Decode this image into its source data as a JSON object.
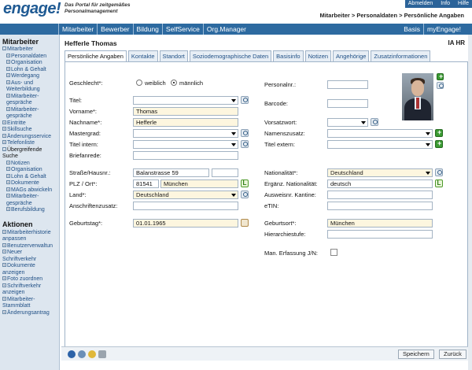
{
  "app": {
    "logo": "engage!",
    "tagline": "Das Portal für zeitgemäßes Personalmanagement",
    "top_links": [
      "Abmelden",
      "Info",
      "Hilfe"
    ],
    "breadcrumb": "Mitarbeiter > Personaldaten > Persönliche Angaben"
  },
  "nav": {
    "left": [
      "Mitarbeiter",
      "Bewerber",
      "Bildung",
      "SelfService",
      "Org.Manager"
    ],
    "right": [
      "Basis",
      "myEngage!"
    ]
  },
  "sidebar": {
    "section1": "Mitarbeiter",
    "items": [
      {
        "label": "Mitarbeiter",
        "level": 1,
        "sym": "-"
      },
      {
        "label": "Personaldaten",
        "level": 2,
        "sym": "+"
      },
      {
        "label": "Organisation",
        "level": 2,
        "sym": "+"
      },
      {
        "label": "Lohn & Gehalt",
        "level": 2,
        "sym": "+"
      },
      {
        "label": "Werdegang",
        "level": 2,
        "sym": "+"
      },
      {
        "label": "Aus- und Weiterbildung",
        "level": 2,
        "sym": "+"
      },
      {
        "label": "Mitarbeiter-gespräche",
        "level": 2,
        "sym": "+"
      },
      {
        "label": "Mitarbeiter-gespräche",
        "level": 2,
        "sym": "+"
      },
      {
        "label": "Eintritte",
        "level": 1,
        "sym": "+"
      },
      {
        "label": "Skillsuche",
        "level": 1,
        "sym": "+"
      },
      {
        "label": "Änderungsservice",
        "level": 1,
        "sym": "+"
      },
      {
        "label": "Telefonliste",
        "level": 1,
        "sym": "+"
      },
      {
        "label": "Übergreifende Suche",
        "level": 1,
        "sym": "-",
        "dark": true
      },
      {
        "label": "Notizen",
        "level": 2,
        "sym": "+"
      },
      {
        "label": "Organisation",
        "level": 2,
        "sym": "+"
      },
      {
        "label": "Lohn & Gehalt",
        "level": 2,
        "sym": "+"
      },
      {
        "label": "Dokumente",
        "level": 2,
        "sym": "+"
      },
      {
        "label": "MAGs abwickeln",
        "level": 2,
        "sym": "+"
      },
      {
        "label": "Mitarbeiter-gespräche",
        "level": 2,
        "sym": "+"
      },
      {
        "label": "Berufsbildung",
        "level": 2,
        "sym": "+"
      }
    ],
    "section2": "Aktionen",
    "actions": [
      "Mitarbeiterhistorie anpassen",
      "Benutzerverwaltun",
      "Neuer Schriftverkehr",
      "Dokumente anzeigen",
      "Foto zuordnen",
      "Schriftverkehr anzeigen",
      "Mitarbeiter-Stammblatt",
      "Änderungsantrag"
    ]
  },
  "page": {
    "title": "Hefferle Thomas",
    "tag": "IA HR",
    "tabs": [
      "Persönliche Angaben",
      "Kontakte",
      "Standort",
      "Soziodemographische Daten",
      "Basisinfo",
      "Notizen",
      "Angehörige",
      "Zusatzinformationen"
    ],
    "active_tab": 0
  },
  "form": {
    "gender_label": "Geschlecht*:",
    "gender_female": "weiblich",
    "gender_male": "männlich",
    "gender_selected": "männlich",
    "titel_label": "Titel:",
    "vorname_label": "Vorname*:",
    "vorname": "Thomas",
    "nachname_label": "Nachname*:",
    "nachname": "Hefferle",
    "mastergrad_label": "Mastergrad:",
    "titel_intern_label": "Titel intern:",
    "briefanrede_label": "Briefanrede:",
    "strasse_label": "Straße/Hausnr.:",
    "strasse": "Balanstrasse 59",
    "plz_label": "PLZ / Ort*:",
    "plz": "81541",
    "ort": "München",
    "land_label": "Land*:",
    "land": "Deutschland",
    "anschrift_label": "Anschriftenzusatz:",
    "geburtstag_label": "Geburtstag*:",
    "geburtstag": "01.01.1965",
    "personalnr_label": "Personalnr.:",
    "barcode_label": "Barcode:",
    "vorsatzwort_label": "Vorsatzwort:",
    "namenszusatz_label": "Namenszusatz:",
    "titel_extern_label": "Titel extern:",
    "nationalitaet_label": "Nationalität*:",
    "nationalitaet": "Deutschland",
    "ergaenz_label": "Ergänz. Nationalität:",
    "ergaenz": "deutsch",
    "ausweis_label": "Ausweisnr. Kantine:",
    "etin_label": "eTIN:",
    "geburtsort_label": "Geburtsort*:",
    "geburtsort": "München",
    "hierarchie_label": "Hierarchiestufe:",
    "man_erfassung_label": "Man. Erfassung J/N:"
  },
  "footer": {
    "save": "Speichern",
    "back": "Zurück"
  }
}
